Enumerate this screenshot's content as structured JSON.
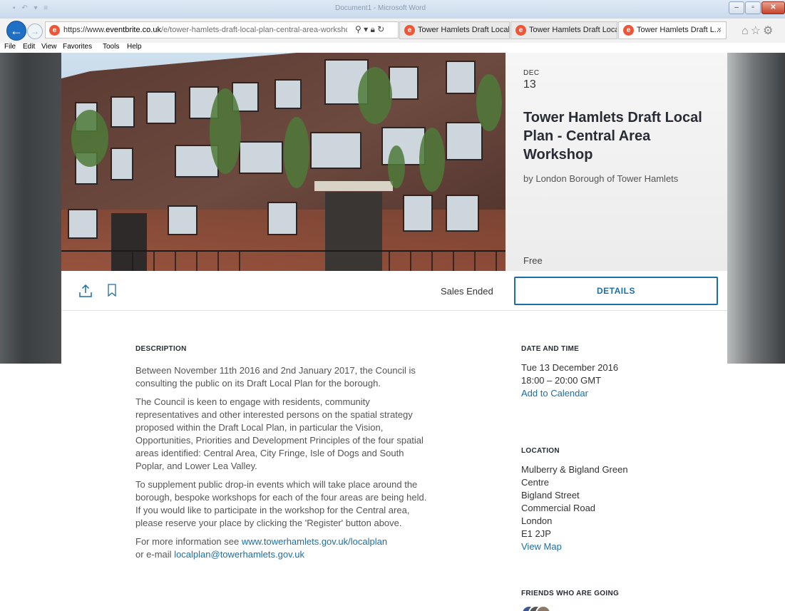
{
  "browser": {
    "window_title": "Document1 - Microsoft Word",
    "url_prefix": "https://www.",
    "url_host": "eventbrite.co.uk",
    "url_path": "/e/tower-hamlets-draft-local-plan-central-area-workshop-",
    "tabs": [
      {
        "label": "Tower Hamlets Draft Local..."
      },
      {
        "label": "Tower Hamlets Draft Local..."
      },
      {
        "label": "Tower Hamlets Draft L...",
        "active": true
      }
    ],
    "menu": [
      "File",
      "Edit",
      "View",
      "Favorites",
      "Tools",
      "Help"
    ],
    "favicon_letter": "e"
  },
  "event": {
    "month": "DEC",
    "day": "13",
    "title": "Tower Hamlets Draft Local Plan - Central Area Workshop",
    "organizer": "by London Borough of Tower Hamlets",
    "price": "Free",
    "sales_status": "Sales Ended",
    "details_label": "DETAILS"
  },
  "description": {
    "heading": "DESCRIPTION",
    "p1": "Between November 11th 2016 and 2nd January 2017, the Council is consulting the public on its Draft Local Plan for the borough.",
    "p2": "The Council is keen to engage with residents, community representatives and other interested persons on the spatial strategy proposed within the Draft Local Plan, in particular the Vision, Opportunities, Priorities and Development Principles of the four spatial areas identified: Central Area, City Fringe, Isle of Dogs and South Poplar, and Lower Lea Valley.",
    "p3": "To supplement public drop-in events which will take place around the borough, bespoke workshops for each of the four areas are being held. If you would like to participate in the workshop for the Central area, please reserve your place by clicking the 'Register' button above.",
    "p4_prefix": "For more information see ",
    "p4_link1": "www.towerhamlets.gov.uk/localplan",
    "p4_mid": "or e-mail ",
    "p4_link2": "localplan@towerhamlets.gov.uk"
  },
  "date_time": {
    "heading": "DATE AND TIME",
    "date": "Tue 13 December 2016",
    "time": "18:00 – 20:00 GMT",
    "add_calendar": "Add to Calendar"
  },
  "location": {
    "heading": "LOCATION",
    "lines": [
      "Mulberry & Bigland Green",
      "Centre",
      "Bigland Street",
      "Commercial Road",
      "London",
      "E1 2JP"
    ],
    "view_map": "View Map"
  },
  "friends": {
    "heading": "FRIENDS WHO ARE GOING"
  },
  "colors": {
    "link": "#1b6fa8",
    "eventbrite_orange": "#f05537"
  }
}
